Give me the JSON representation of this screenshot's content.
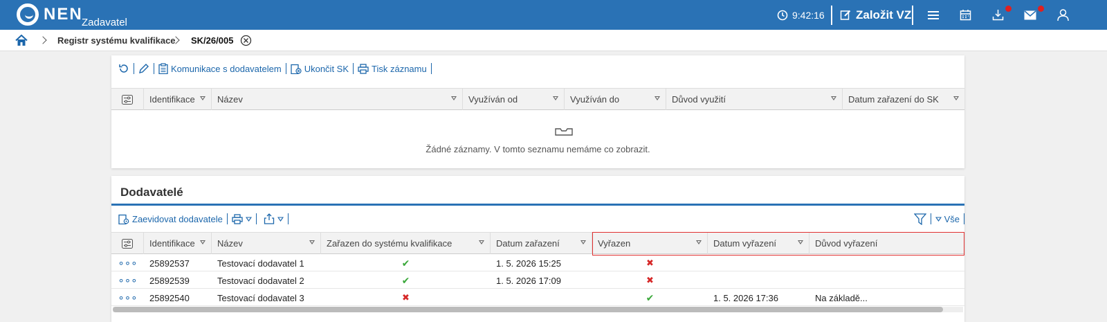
{
  "header": {
    "logo": "NEN",
    "role": "Zadavatel",
    "time": "9:42:16",
    "create_label": "Založit VZ",
    "icons": [
      "clock-icon",
      "edit-icon",
      "menu-icon",
      "calendar-icon",
      "download-icon",
      "mail-icon",
      "user-icon"
    ],
    "accent": "#2a72b5"
  },
  "breadcrumb": {
    "items": [
      "Registr systému kvalifikace",
      "SK/26/005"
    ]
  },
  "top_toolbar": {
    "communication": "Komunikace s dodavatelem",
    "end": "Ukončit SK",
    "print": "Tisk záznamu"
  },
  "top_grid": {
    "columns": [
      "Identifikace",
      "Název",
      "Využíván od",
      "Využíván do",
      "Důvod využití",
      "Datum zařazení do SK"
    ],
    "empty_text": "Žádné záznamy. V tomto seznamu nemáme co zobrazit."
  },
  "suppliers": {
    "title": "Dodavatelé",
    "register_label": "Zaevidovat dodavatele",
    "filter_all": "Vše",
    "columns": [
      "Identifikace",
      "Název",
      "Zařazen do systému kvalifikace",
      "Datum zařazení",
      "Vyřazen",
      "Datum vyřazení",
      "Důvod vyřazení"
    ],
    "rows": [
      {
        "id": "25892537",
        "name": "Testovací dodavatel 1",
        "included": true,
        "date_included": "1. 5. 2026 15:25",
        "excluded": false,
        "date_excluded": "",
        "reason": ""
      },
      {
        "id": "25892539",
        "name": "Testovací dodavatel 2",
        "included": true,
        "date_included": "1. 5. 2026 17:09",
        "excluded": false,
        "date_excluded": "",
        "reason": ""
      },
      {
        "id": "25892540",
        "name": "Testovací dodavatel 3",
        "included": false,
        "date_included": "",
        "excluded": true,
        "date_excluded": "1. 5. 2026 17:36",
        "reason": "Na základě..."
      }
    ],
    "mark_yes": "✔",
    "mark_no": "✖",
    "row_menu": "∘∘∘"
  }
}
